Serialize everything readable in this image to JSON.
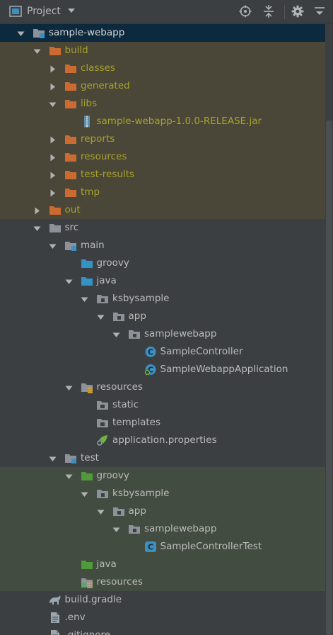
{
  "header": {
    "title": "Project",
    "icons": [
      "project-view-icon",
      "dropdown-chevron-icon",
      "locate-target-icon",
      "collapse-all-icon",
      "settings-gear-icon",
      "hide-panel-icon"
    ]
  },
  "tree": {
    "rows": [
      {
        "name": "sample-webapp",
        "depth": 0,
        "arrow": "down",
        "icon": "module-folder",
        "state": "selected"
      },
      {
        "name": "build",
        "depth": 1,
        "arrow": "down",
        "icon": "folder-orange",
        "state": "excluded"
      },
      {
        "name": "classes",
        "depth": 2,
        "arrow": "right",
        "icon": "folder-orange",
        "state": "excluded"
      },
      {
        "name": "generated",
        "depth": 2,
        "arrow": "right",
        "icon": "folder-orange",
        "state": "excluded"
      },
      {
        "name": "libs",
        "depth": 2,
        "arrow": "down",
        "icon": "folder-orange",
        "state": "excluded"
      },
      {
        "name": "sample-webapp-1.0.0-RELEASE.jar",
        "depth": 3,
        "arrow": "none",
        "icon": "jar-file",
        "state": "excluded"
      },
      {
        "name": "reports",
        "depth": 2,
        "arrow": "right",
        "icon": "folder-orange",
        "state": "excluded"
      },
      {
        "name": "resources",
        "depth": 2,
        "arrow": "right",
        "icon": "folder-orange",
        "state": "excluded"
      },
      {
        "name": "test-results",
        "depth": 2,
        "arrow": "right",
        "icon": "folder-orange",
        "state": "excluded"
      },
      {
        "name": "tmp",
        "depth": 2,
        "arrow": "right",
        "icon": "folder-orange",
        "state": "excluded"
      },
      {
        "name": "out",
        "depth": 1,
        "arrow": "right",
        "icon": "folder-orange",
        "state": "excluded"
      },
      {
        "name": "src",
        "depth": 1,
        "arrow": "down",
        "icon": "folder-gray",
        "state": "normal"
      },
      {
        "name": "main",
        "depth": 2,
        "arrow": "down",
        "icon": "module-folder",
        "state": "normal"
      },
      {
        "name": "groovy",
        "depth": 3,
        "arrow": "none",
        "icon": "folder-blue",
        "state": "normal"
      },
      {
        "name": "java",
        "depth": 3,
        "arrow": "down",
        "icon": "folder-blue",
        "state": "normal"
      },
      {
        "name": "ksbysample",
        "depth": 4,
        "arrow": "down",
        "icon": "package",
        "state": "normal"
      },
      {
        "name": "app",
        "depth": 5,
        "arrow": "down",
        "icon": "package",
        "state": "normal"
      },
      {
        "name": "samplewebapp",
        "depth": 6,
        "arrow": "down",
        "icon": "package",
        "state": "normal"
      },
      {
        "name": "SampleController",
        "depth": 7,
        "arrow": "none",
        "icon": "class",
        "state": "normal"
      },
      {
        "name": "SampleWebappApplication",
        "depth": 7,
        "arrow": "none",
        "icon": "spring-class",
        "state": "normal"
      },
      {
        "name": "resources",
        "depth": 3,
        "arrow": "down",
        "icon": "resources-folder",
        "state": "normal"
      },
      {
        "name": "static",
        "depth": 4,
        "arrow": "none",
        "icon": "folder-gray-dot",
        "state": "normal"
      },
      {
        "name": "templates",
        "depth": 4,
        "arrow": "none",
        "icon": "folder-gray-dot",
        "state": "normal"
      },
      {
        "name": "application.properties",
        "depth": 4,
        "arrow": "none",
        "icon": "spring-properties",
        "state": "normal"
      },
      {
        "name": "test",
        "depth": 2,
        "arrow": "down",
        "icon": "module-folder",
        "state": "normal"
      },
      {
        "name": "groovy",
        "depth": 3,
        "arrow": "down",
        "icon": "folder-green",
        "state": "test"
      },
      {
        "name": "ksbysample",
        "depth": 4,
        "arrow": "down",
        "icon": "package",
        "state": "test"
      },
      {
        "name": "app",
        "depth": 5,
        "arrow": "down",
        "icon": "package",
        "state": "test"
      },
      {
        "name": "samplewebapp",
        "depth": 6,
        "arrow": "down",
        "icon": "package",
        "state": "test"
      },
      {
        "name": "SampleControllerTest",
        "depth": 7,
        "arrow": "none",
        "icon": "groovy-class",
        "state": "test"
      },
      {
        "name": "java",
        "depth": 3,
        "arrow": "none",
        "icon": "folder-green",
        "state": "test"
      },
      {
        "name": "resources",
        "depth": 3,
        "arrow": "none",
        "icon": "test-resources-folder",
        "state": "test"
      },
      {
        "name": "build.gradle",
        "depth": 1,
        "arrow": "none",
        "icon": "gradle-file",
        "state": "normal"
      },
      {
        "name": ".env",
        "depth": 1,
        "arrow": "none",
        "icon": "text-file",
        "state": "normal"
      },
      {
        "name": ".gitignore",
        "depth": 1,
        "arrow": "none",
        "icon": "text-file",
        "state": "normal"
      }
    ]
  },
  "colors": {
    "panel_bg": "#3c3f41",
    "selected_bg": "#0d293e",
    "excluded_bg": "#4a4738",
    "test_bg": "#434c40",
    "excluded_text": "#a8a22b",
    "normal_text": "#bbbbbb",
    "folder_orange": "#cc6b31",
    "folder_blue": "#3592c4",
    "folder_green": "#4f9a3a",
    "folder_gray": "#8d9298"
  }
}
